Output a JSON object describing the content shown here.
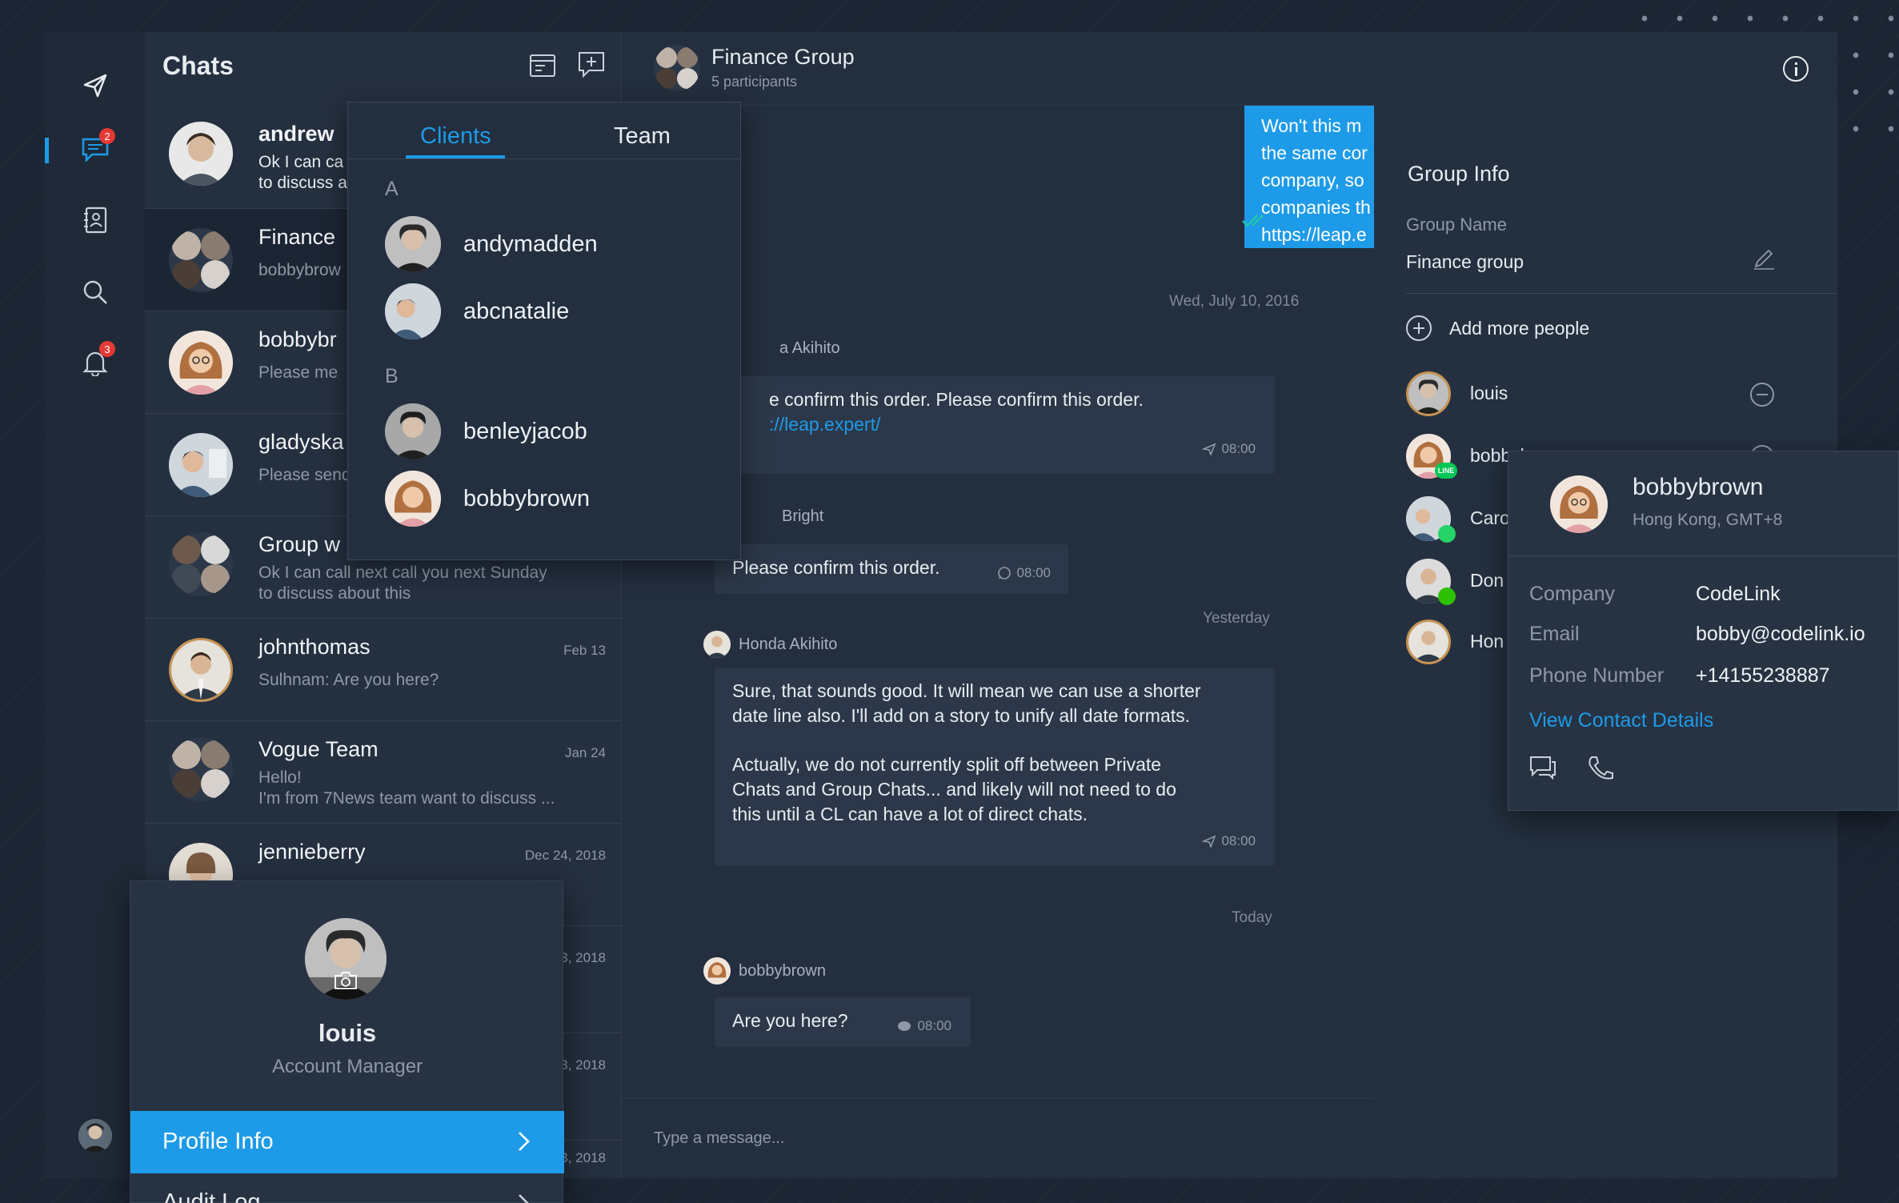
{
  "colors": {
    "accent": "#1e9be8",
    "background": "#1c2533",
    "panel": "#232e3e",
    "bubble": "#2c3849",
    "badge": "#e53935",
    "line_green": "#06c755",
    "whatsapp_green": "#25d366",
    "wechat_green": "#2dc100"
  },
  "rail": {
    "items": [
      {
        "icon": "send-logo-icon"
      },
      {
        "icon": "chat-icon",
        "badge": "2",
        "active": true
      },
      {
        "icon": "contacts-book-icon"
      },
      {
        "icon": "search-icon"
      },
      {
        "icon": "bell-icon",
        "badge": "3"
      }
    ],
    "user_avatar": "user-avatar"
  },
  "chats": {
    "title": "Chats",
    "items": [
      {
        "name": "andrew",
        "preview": "Ok I can call next call you next Sunday to discuss about this",
        "preview_line1": "Ok I can ca",
        "preview_line2": "to discuss a",
        "date": "",
        "bold": true
      },
      {
        "name": "Finance Group",
        "name_visible": "Finance",
        "preview": "bobbybrow",
        "date": "",
        "selected": true
      },
      {
        "name": "bobbybrown",
        "name_visible": "bobbybr",
        "preview": "Please me",
        "date": ""
      },
      {
        "name": "gladyska",
        "name_visible": "gladyska",
        "preview": "Please send",
        "date": ""
      },
      {
        "name": "Group w",
        "name_visible": "Group w",
        "preview_line1": "Ok I can call next call you next Sunday",
        "preview_line2": "to discuss about this",
        "date": ""
      },
      {
        "name": "johnthomas",
        "preview": "Sulhnam: Are you here?",
        "date": "Feb 13"
      },
      {
        "name": "Vogue Team",
        "preview_line1": "Hello!",
        "preview_line2": "I'm from 7News team want  to discuss ...",
        "date": "Jan 24"
      },
      {
        "name": "jennieberry",
        "preview": "",
        "date": "Dec 24, 2018"
      },
      {
        "name": "",
        "preview": "",
        "date": "3, 2018"
      },
      {
        "name": "",
        "preview": "",
        "date": "3, 2018"
      },
      {
        "name": "",
        "preview": "",
        "date": "3, 2018"
      }
    ]
  },
  "dropdown": {
    "tabs": [
      "Clients",
      "Team"
    ],
    "active_tab": "Clients",
    "sections": [
      {
        "letter": "A",
        "items": [
          "andymadden",
          "abcnatalie"
        ]
      },
      {
        "letter": "B",
        "items": [
          "benleyjacob",
          "bobbybrown"
        ]
      }
    ]
  },
  "pane": {
    "title": "Finance Group",
    "subtitle": "5 participants",
    "outgoing": {
      "lines": [
        "Won't this m",
        "the same cor",
        "company, so",
        "companies th",
        "https://leap.e"
      ]
    },
    "messages": [
      {
        "day": "Wed, July 10, 2016",
        "sender": "a Akihito",
        "text_lines": [
          "e confirm this order. Please confirm this order.",
          "://leap.expert/"
        ],
        "time": "08:00",
        "channel": "leap"
      },
      {
        "sender": "Bright",
        "text_lines": [
          "Please confirm this order."
        ],
        "time": "08:00",
        "channel": "whatsapp"
      },
      {
        "day": "Yesterday",
        "sender": "Honda Akihito",
        "text_lines": [
          "Sure, that sounds good. It will mean we can use a shorter",
          "date line also. I'll add on a story to unify all date formats.",
          "",
          "Actually, we do not currently split off between Private",
          "Chats and Group Chats... and likely will not need to do",
          "this until a CL can have a lot of direct chats."
        ],
        "time": "08:00",
        "channel": "leap"
      },
      {
        "day": "Today",
        "sender": "bobbybrown",
        "text_lines": [
          "Are you here?"
        ],
        "time": "08:00",
        "channel": "wechat"
      }
    ],
    "input_placeholder": "Type a message..."
  },
  "group_info": {
    "title": "Group Info",
    "group_name_label": "Group Name",
    "group_name": "Finance group",
    "add_people": "Add more people",
    "members": [
      {
        "name": "louis",
        "channel": ""
      },
      {
        "name": "bobbybrown",
        "channel": "LINE"
      },
      {
        "name": "Caro",
        "channel": "whatsapp"
      },
      {
        "name": "Don",
        "channel": "wechat"
      },
      {
        "name": "Hon",
        "channel": ""
      }
    ]
  },
  "contact_card": {
    "name": "bobbybrown",
    "location": "Hong Kong, GMT+8",
    "rows": [
      {
        "label": "Company",
        "value": "CodeLink"
      },
      {
        "label": "Email",
        "value": "bobby@codelink.io"
      },
      {
        "label": "Phone Number",
        "value": "+14155238887"
      }
    ],
    "link": "View Contact Details"
  },
  "profile_card": {
    "name": "louis",
    "role": "Account Manager",
    "menu": [
      "Profile Info",
      "Audit Log"
    ]
  }
}
